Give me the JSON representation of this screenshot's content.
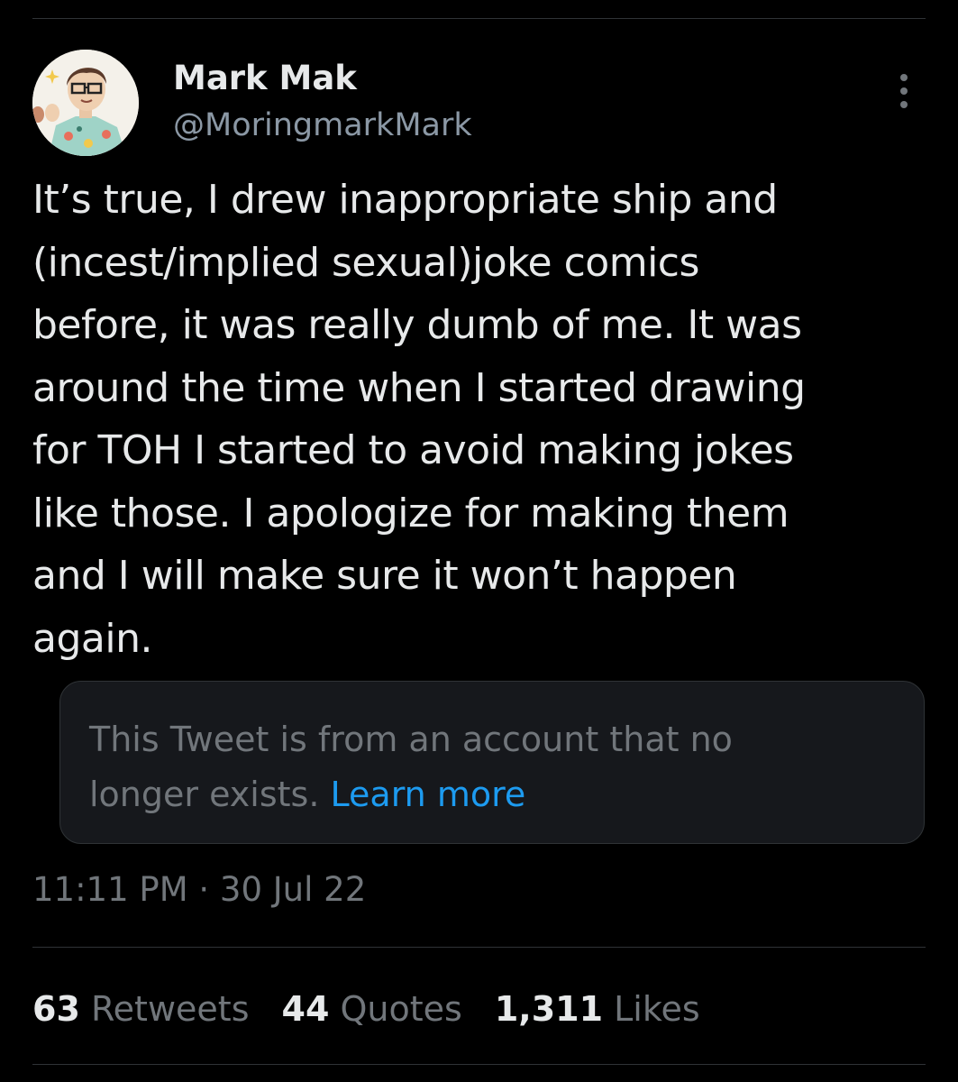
{
  "author": {
    "display_name": "Mark Mak",
    "handle": "@MoringmarkMark",
    "avatar_icon": "cartoon-avatar-icon"
  },
  "menu": {
    "icon": "more-vertical-icon"
  },
  "tweet": {
    "lines": [
      "It’s true, I drew inappropriate ship and",
      "(incest/implied sexual)joke comics",
      "before, it was really dumb of me. It was",
      "around the time when I started drawing",
      "for TOH I started to avoid making jokes",
      "like those. I apologize for making them",
      "and I will make sure it won’t happen",
      "again."
    ]
  },
  "notice": {
    "line1": "This Tweet is from an account that no",
    "line2": "longer exists.",
    "link": "Learn more"
  },
  "timestamp": "11:11 PM · 30 Jul 22",
  "stats": {
    "retweets_count": "63",
    "retweets_label": "Retweets",
    "quotes_count": "44",
    "quotes_label": "Quotes",
    "likes_count": "1,311",
    "likes_label": "Likes"
  },
  "colors": {
    "background": "#000000",
    "primary_text": "#e7e9ea",
    "secondary_text": "#71767b",
    "link": "#1d9bf0",
    "notice_bg": "#16181c",
    "divider": "#2f3336"
  }
}
